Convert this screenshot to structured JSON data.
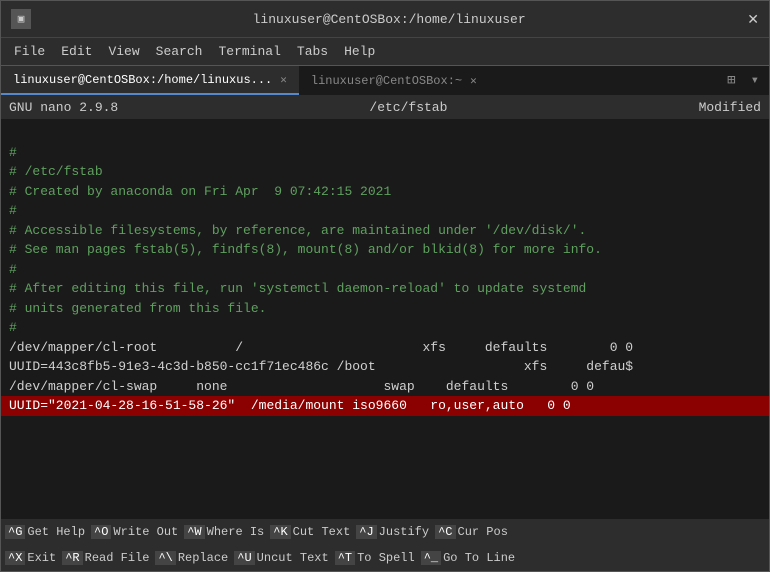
{
  "window": {
    "title": "linuxuser@CentOSBox:/home/linuxuser",
    "close_button": "✕"
  },
  "menu": {
    "items": [
      "File",
      "Edit",
      "View",
      "Search",
      "Terminal",
      "Tabs",
      "Help"
    ]
  },
  "tabs": [
    {
      "label": "linuxuser@CentOSBox:/home/linuxus...",
      "active": true
    },
    {
      "label": "linuxuser@CentOSBox:~",
      "active": false
    }
  ],
  "nano_header": {
    "version": "GNU nano 2.9.8",
    "filename": "/etc/fstab",
    "status": "Modified"
  },
  "editor": {
    "lines": [
      {
        "text": "",
        "type": "normal"
      },
      {
        "text": "#",
        "type": "comment"
      },
      {
        "text": "# /etc/fstab",
        "type": "comment"
      },
      {
        "text": "# Created by anaconda on Fri Apr  9 07:42:15 2021",
        "type": "comment"
      },
      {
        "text": "#",
        "type": "comment"
      },
      {
        "text": "# Accessible filesystems, by reference, are maintained under '/dev/disk/'.",
        "type": "comment"
      },
      {
        "text": "# See man pages fstab(5), findfs(8), mount(8) and/or blkid(8) for more info.",
        "type": "comment"
      },
      {
        "text": "#",
        "type": "comment"
      },
      {
        "text": "# After editing this file, run 'systemctl daemon-reload' to update systemd",
        "type": "comment"
      },
      {
        "text": "# units generated from this file.",
        "type": "comment"
      },
      {
        "text": "#",
        "type": "comment"
      },
      {
        "text": "/dev/mapper/cl-root          /                       xfs     defaults        0 0",
        "type": "normal"
      },
      {
        "text": "UUID=443c8fb5-91e3-4c3d-b850-cc1f71ec486c /boot                   xfs     defau$",
        "type": "normal"
      },
      {
        "text": "/dev/mapper/cl-swap     none                    swap    defaults        0 0",
        "type": "normal"
      },
      {
        "text": "UUID=\"2021-04-28-16-51-58-26\"  /media/mount iso9660   ro,user,auto   0 0",
        "type": "highlighted"
      }
    ]
  },
  "shortcuts": {
    "row1": [
      {
        "key": "^G",
        "label": "Get Help"
      },
      {
        "key": "^O",
        "label": "Write Out"
      },
      {
        "key": "^W",
        "label": "Where Is"
      },
      {
        "key": "^K",
        "label": "Cut Text"
      },
      {
        "key": "^J",
        "label": "Justify"
      },
      {
        "key": "^C",
        "label": "Cur Pos"
      }
    ],
    "row2": [
      {
        "key": "^X",
        "label": "Exit"
      },
      {
        "key": "^R",
        "label": "Read File"
      },
      {
        "key": "^\\",
        "label": "Replace"
      },
      {
        "key": "^U",
        "label": "Uncut Text"
      },
      {
        "key": "^T",
        "label": "To Spell"
      },
      {
        "key": "^_",
        "label": "Go To Line"
      }
    ]
  }
}
